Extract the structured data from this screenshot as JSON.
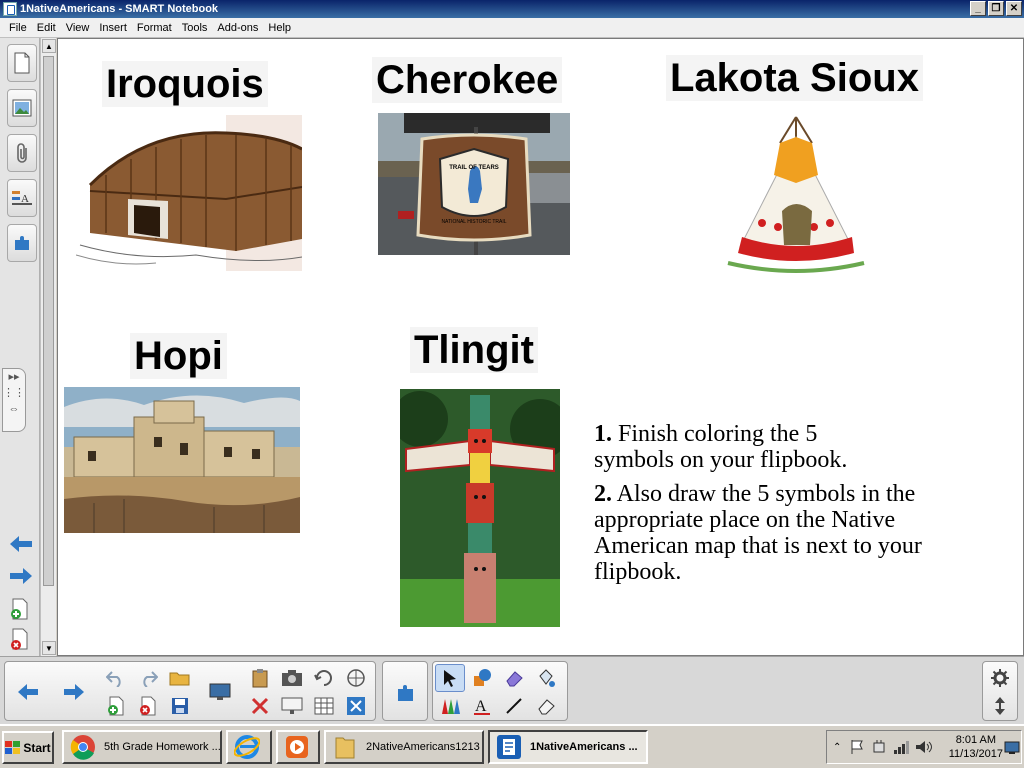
{
  "window": {
    "title": "1NativeAmericans - SMART Notebook"
  },
  "menu": [
    "File",
    "Edit",
    "View",
    "Insert",
    "Format",
    "Tools",
    "Add-ons",
    "Help"
  ],
  "page": {
    "tribes": [
      {
        "name": "Iroquois"
      },
      {
        "name": "Cherokee"
      },
      {
        "name": "Lakota Sioux"
      },
      {
        "name": "Hopi"
      },
      {
        "name": "Tlingit"
      }
    ],
    "sign": {
      "line1": "TRAIL OF TEARS",
      "line2": "NATIONAL HISTORIC TRAIL"
    },
    "instructions": {
      "step1_number": "1.",
      "step1_text": " Finish coloring the 5",
      "step1_text2": "symbols on your flipbook.",
      "step2_number": "2.",
      "step2_text": " Also draw the 5 symbols in the appropriate place on the Native American map that is next to your flipbook."
    }
  },
  "taskbar": {
    "start_label": "Start",
    "tasks": [
      {
        "label": "5th Grade Homework ..."
      },
      {
        "label": "2NativeAmericans1213"
      },
      {
        "label": "1NativeAmericans ..."
      }
    ],
    "clock_time": "8:01 AM",
    "clock_date": "11/13/2017"
  },
  "colors": {
    "accent": "#1a5fb4",
    "selection": "#c9ddf5",
    "canvas": "#ffffff"
  }
}
